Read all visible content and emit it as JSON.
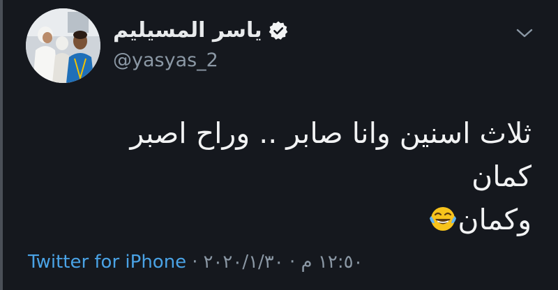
{
  "tweet": {
    "author": {
      "display_name": "ياسر المسيليم",
      "handle": "@yasyas_2",
      "verified": true,
      "avatar_icon": "profile-photo"
    },
    "text_lines": [
      "ثلاث اسنين وانا صابر .. وراح اصبر كمان",
      "وكمان"
    ],
    "emoji": "face-with-tears-of-joy",
    "source": "Twitter for iPhone",
    "separator": "·",
    "timestamp": "١٢:٥٠ م · ٢٠٢٠/١/٣٠"
  },
  "colors": {
    "background": "#15181e",
    "text": "#f2f3f4",
    "secondary": "#8b98a5",
    "link": "#4aa3e6"
  }
}
